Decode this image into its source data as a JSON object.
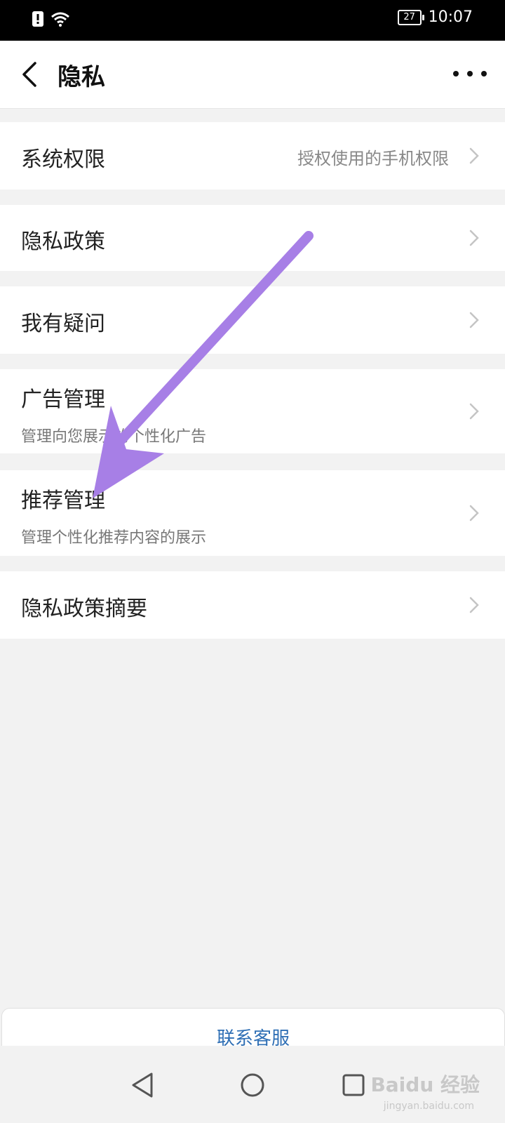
{
  "status_bar": {
    "battery_level": "27",
    "time": "10:07",
    "icons": [
      "alert-icon",
      "wifi-icon"
    ]
  },
  "header": {
    "title": "隐私",
    "back_icon": "back-chevron-icon",
    "more_icon": "more-dots-icon"
  },
  "menu": [
    {
      "title": "系统权限",
      "value": "授权使用的手机权限",
      "subtitle": ""
    },
    {
      "title": "隐私政策",
      "value": "",
      "subtitle": ""
    },
    {
      "title": "我有疑问",
      "value": "",
      "subtitle": ""
    },
    {
      "title": "广告管理",
      "value": "",
      "subtitle": "管理向您展示的个性化广告"
    },
    {
      "title": "推荐管理",
      "value": "",
      "subtitle": "管理个性化推荐内容的展示"
    },
    {
      "title": "隐私政策摘要",
      "value": "",
      "subtitle": ""
    }
  ],
  "footer": {
    "contact_label": "联系客服"
  },
  "annotation": {
    "arrow_color": "#a77fe6"
  },
  "watermark": {
    "text": "Baidu 经验",
    "sub": "jingyan.baidu.com"
  },
  "colors": {
    "accent": "#2f6fb5",
    "background": "#f2f2f2"
  }
}
